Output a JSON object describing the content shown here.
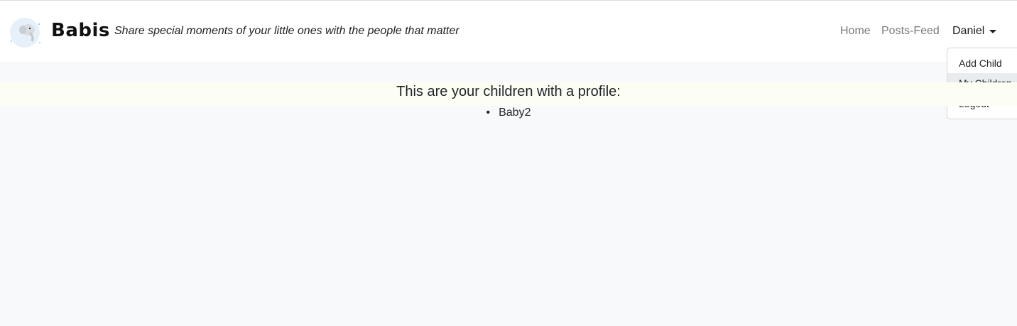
{
  "navbar": {
    "brand": "Babis",
    "tagline": "Share special moments of your little ones with the people that matter",
    "logo_icon": "baby-elephant-moon-icon",
    "links": {
      "home": "Home",
      "feed": "Posts-Feed",
      "user": "Daniel"
    }
  },
  "dropdown": {
    "items": [
      {
        "label": "Add Child"
      },
      {
        "label": "My Children",
        "active": true
      },
      {
        "label": "Logout"
      }
    ]
  },
  "main": {
    "heading": "This are your children with a profile:",
    "children": [
      "Baby2"
    ]
  },
  "colors": {
    "page_bg": "#f8f9fa",
    "banner_bg": "#fcfef4",
    "active_item_bg": "#e9ecef"
  }
}
